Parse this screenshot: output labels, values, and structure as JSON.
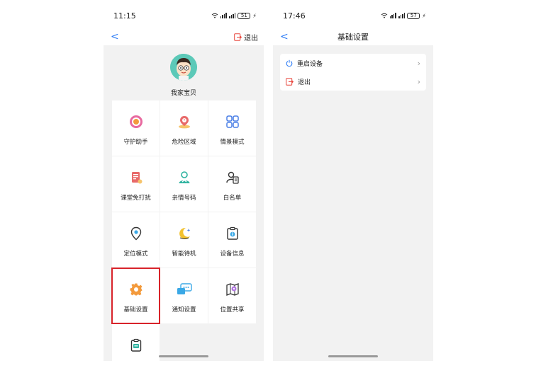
{
  "left_screen": {
    "status": {
      "time": "11:15",
      "battery": "51"
    },
    "nav": {
      "back": "<",
      "exit_label": "退出"
    },
    "profile": {
      "name": "我家宝贝"
    },
    "grid": [
      {
        "label": "守护助手",
        "icon": "guard-icon"
      },
      {
        "label": "危险区域",
        "icon": "danger-zone-icon"
      },
      {
        "label": "情景模式",
        "icon": "scene-mode-icon"
      },
      {
        "label": "课堂免打扰",
        "icon": "class-dnd-icon"
      },
      {
        "label": "亲情号码",
        "icon": "family-number-icon"
      },
      {
        "label": "白名单",
        "icon": "whitelist-icon"
      },
      {
        "label": "定位模式",
        "icon": "location-mode-icon"
      },
      {
        "label": "智能待机",
        "icon": "smart-standby-icon"
      },
      {
        "label": "设备信息",
        "icon": "device-info-icon"
      },
      {
        "label": "基础设置",
        "icon": "basic-settings-icon"
      },
      {
        "label": "通知设置",
        "icon": "notification-settings-icon"
      },
      {
        "label": "位置共享",
        "icon": "location-share-icon"
      }
    ]
  },
  "right_screen": {
    "status": {
      "time": "17:46",
      "battery": "57"
    },
    "nav": {
      "back": "<",
      "title": "基础设置"
    },
    "settings": [
      {
        "label": "重启设备",
        "icon": "power-icon"
      },
      {
        "label": "退出",
        "icon": "exit-icon"
      }
    ]
  },
  "colors": {
    "accent": "#2f7df6",
    "highlight": "#d8232a",
    "background": "#f2f2f2"
  }
}
